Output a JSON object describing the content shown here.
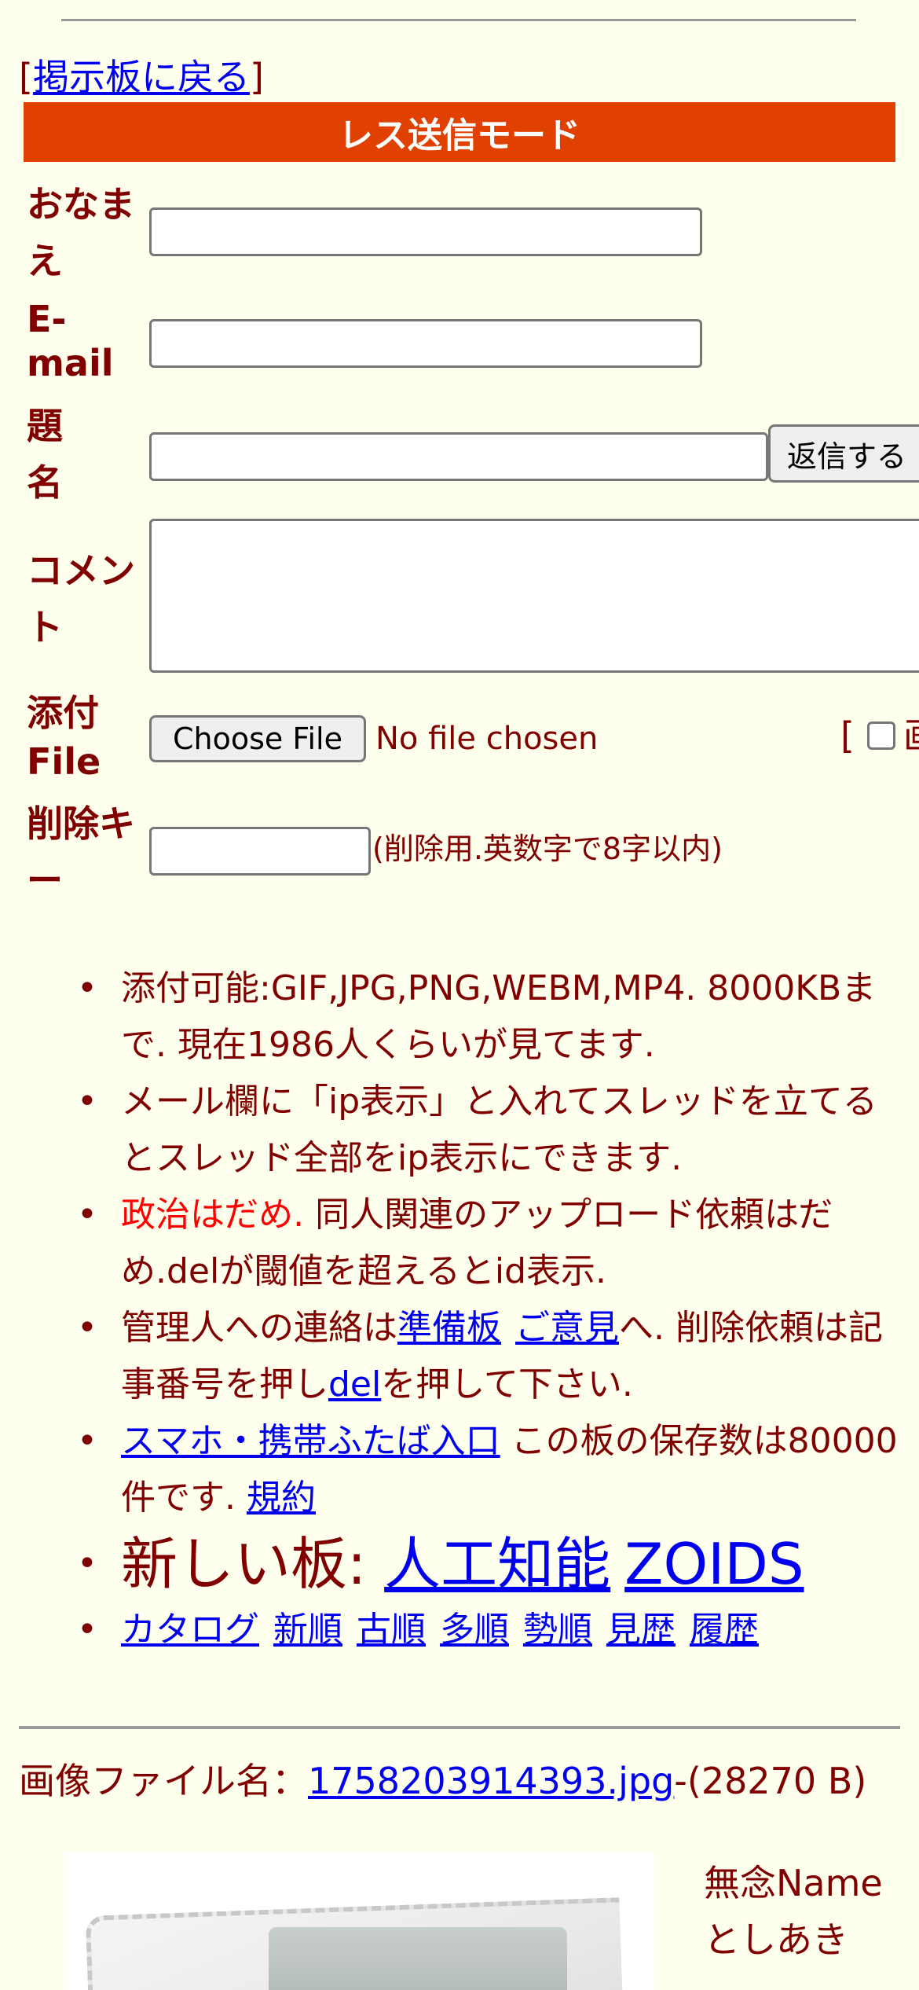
{
  "nav": {
    "bracket_open": "[",
    "back_label": "掲示板に戻る",
    "bracket_close": "]"
  },
  "mode_title": "レス送信モード",
  "form": {
    "name_label_1": "おなま",
    "name_label_2": "え",
    "email_label_1": "E-",
    "email_label_2": "mail",
    "subject_label_1": "題",
    "subject_label_2": "名",
    "submit_label": "返信する",
    "comment_label_1": "コメン",
    "comment_label_2": "ト",
    "attach_label_1": "添付",
    "attach_label_2": "File",
    "choose_file_label": "Choose File",
    "no_file_text": "No file chosen",
    "draw_bracket": "[",
    "draw_glyph": "画",
    "delkey_label_1": "削除キ",
    "delkey_label_2": "ー",
    "delkey_hint": "(削除用.英数字で8字以内)"
  },
  "rules": {
    "r1": "添付可能:GIF,JPG,PNG,WEBM,MP4. 8000KBまで. 現在1986人くらいが見てます.",
    "r2": "メール欄に「ip表示」と入れてスレッドを立てるとスレッド全部をip表示にできます.",
    "r3_red": "政治はだめ.",
    "r3_rest": " 同人関連のアップロード依頼はだめ.delが閾値を超えるとid表示.",
    "r4_pre": "管理人への連絡は",
    "r4_link1": "準備板",
    "r4_link2": "ご意見",
    "r4_mid": "へ. 削除依頼は記事番号を押し",
    "r4_link3": "del",
    "r4_post": "を押して下さい.",
    "r5_link": "スマホ・携帯ふたば入口",
    "r5_text": " この板の保存数は80000件です. ",
    "r5_link2": "規約",
    "r6_text": "新しい板: ",
    "r6_link1": "人工知能",
    "r6_link2": "ZOIDS",
    "r7_links": [
      "カタログ",
      "新順",
      "古順",
      "多順",
      "勢順",
      "見歴",
      "履歴"
    ]
  },
  "post": {
    "file_prefix": "画像ファイル名：",
    "file_name": "1758203914393.jpg",
    "file_size": "-(28270 B)",
    "subject": "無念Name",
    "name": "としあき"
  }
}
